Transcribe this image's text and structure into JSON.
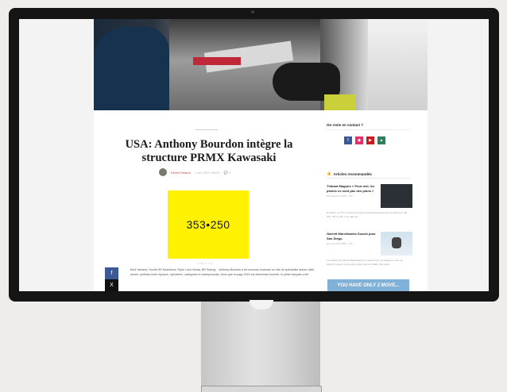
{
  "article": {
    "title": "USA: Anthony Bourdon intègre la structure PRMX Kawasaki",
    "author": "Kévin Frelaud",
    "date": "1 déc 2023 06h00",
    "comments": "0",
    "ad_text": "353•250",
    "ad_label": "PUBLICITÉ",
    "body": "Boril Yamaha, Honda SR Motoblouz, Ryan Lock Honda, BR Racing… Anthony Bourdon a de nouveau endossé un rôle de spécialiste autour cette année, profitant entre équipes, cylindrées, catégories et championnats. Alors que la page 2024 est désormais tournée, le pilote français a été"
  },
  "share": {
    "facebook": "f",
    "x": "X"
  },
  "sidebar": {
    "contact_title": "On reste en contact ?",
    "socials": [
      {
        "icon": "facebook-icon",
        "glyph": "f",
        "color": "#3b5998"
      },
      {
        "icon": "instagram-icon",
        "glyph": "◉",
        "color": "#e1306c"
      },
      {
        "icon": "youtube-icon",
        "glyph": "▶",
        "color": "#cc181e"
      },
      {
        "icon": "strava-icon",
        "glyph": "▲",
        "color": "#2e7d5b"
      }
    ],
    "rec_title": "Articles recommandés",
    "rec_icon": "thumbs-up-icon",
    "items": [
      {
        "title": "Thibaut Maguire « Pour moi, les pilotes ne sont pas des pions »",
        "date": "30 novembre 2023 · 12h",
        "excerpt": "En 2024, Le TTV se dévoile la trente équipes Européennes au 250 pour 125 · 2t/4, 757 et 700, et je date de…"
      },
      {
        "title": "Garrett Marchbanks Suzuki pour San Diego",
        "date": "29 novembre 2023 · 12h",
        "excerpt": "Les débuts de Garrett Marchbanks en Supercross, la catégorie reine, se redirent à partir de lors du rendez-vous de l'AMA. Pas forcé…"
      }
    ],
    "banner": "YOU HAVE ONLY 2 MOVE..."
  }
}
